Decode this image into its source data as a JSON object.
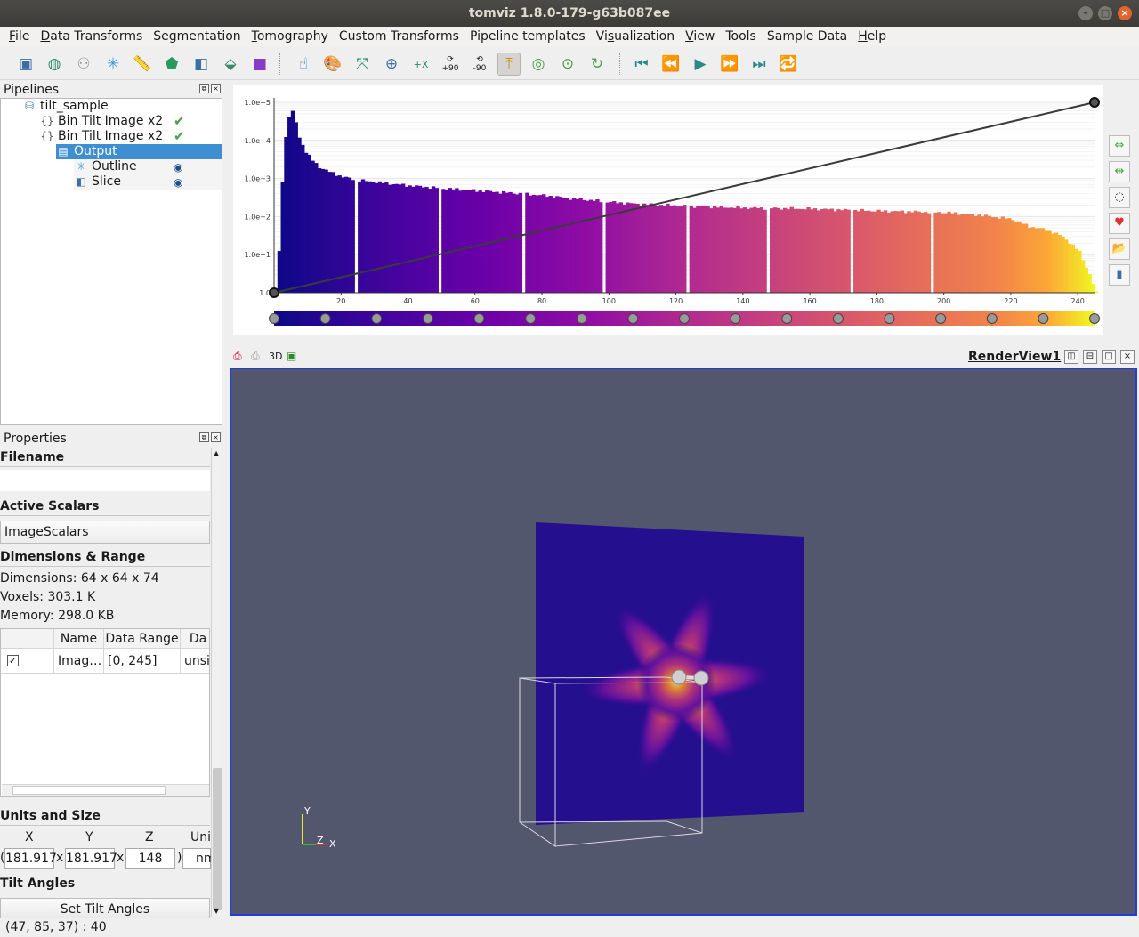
{
  "window": {
    "title": "tomviz 1.8.0-179-g63b087ee"
  },
  "menu": [
    {
      "pre": "",
      "acc": "F",
      "post": "ile"
    },
    {
      "pre": "",
      "acc": "D",
      "post": "ata Transforms"
    },
    {
      "pre": "",
      "acc": "",
      "post": "Segmentation"
    },
    {
      "pre": "",
      "acc": "T",
      "post": "omography"
    },
    {
      "pre": "",
      "acc": "",
      "post": "Custom Transforms"
    },
    {
      "pre": "",
      "acc": "",
      "post": "Pipeline templates"
    },
    {
      "pre": "Vi",
      "acc": "s",
      "post": "ualization"
    },
    {
      "pre": "",
      "acc": "V",
      "post": "iew"
    },
    {
      "pre": "",
      "acc": "",
      "post": "Tools"
    },
    {
      "pre": "",
      "acc": "",
      "post": "Sample Data"
    },
    {
      "pre": "",
      "acc": "H",
      "post": "elp"
    }
  ],
  "toolbar": {
    "rotate_labels": [
      "+90",
      "-90"
    ],
    "x_label": "+X"
  },
  "pipelines": {
    "title": "Pipelines",
    "items": [
      {
        "label": "tilt_sample",
        "icon": "dataset-icon"
      },
      {
        "label": "Bin Tilt Image x2",
        "icon": "braces-icon",
        "status": "complete"
      },
      {
        "label": "Bin Tilt Image x2",
        "icon": "braces-icon",
        "status": "complete"
      },
      {
        "label": "Output",
        "icon": "output-icon",
        "selected": true
      },
      {
        "label": "Outline",
        "icon": "outline-icon",
        "visible": true
      },
      {
        "label": "Slice",
        "icon": "slice-icon",
        "visible": true
      }
    ]
  },
  "properties": {
    "title": "Properties",
    "filename_header": "Filename",
    "filename_value": "",
    "active_scalars_header": "Active Scalars",
    "active_scalars_value": "ImageScalars",
    "dims_header": "Dimensions & Range",
    "dimensions": "Dimensions: 64 x 64 x 74",
    "voxels": "Voxels: 303.1 K",
    "memory": "Memory: 298.0 KB",
    "table": {
      "headers": [
        "",
        "Name",
        "Data Range",
        "Da"
      ],
      "rows": [
        {
          "checked": true,
          "name": "Imag…",
          "range": "[0, 245]",
          "type": "unsig"
        }
      ]
    },
    "units_header": "Units and Size",
    "axes": [
      "X",
      "Y",
      "Z",
      "Uni"
    ],
    "sizes": {
      "x": "181.917",
      "y": "181.917",
      "z": "148",
      "unit": "nm"
    },
    "tilt_header": "Tilt Angles",
    "tilt_button": "Set Tilt Angles"
  },
  "chart_data": {
    "type": "bar",
    "title": "",
    "xlabel": "",
    "ylabel": "",
    "y_scale": "log",
    "xlim": [
      0,
      245
    ],
    "ylim": [
      1,
      100000
    ],
    "y_tick_labels": [
      "1.0",
      "1.0e+1",
      "1.0e+2",
      "1.0e+3",
      "1.0e+4",
      "1.0e+5"
    ],
    "x_tick_labels": [
      "20",
      "40",
      "60",
      "80",
      "100",
      "120",
      "140",
      "160",
      "180",
      "200",
      "220",
      "240"
    ],
    "x_ticks": [
      20,
      40,
      60,
      80,
      100,
      120,
      140,
      160,
      180,
      200,
      220,
      240
    ],
    "colormap": "plasma",
    "opacity_line": {
      "from": [
        0,
        1
      ],
      "to": [
        245,
        100000
      ]
    },
    "colormap_nodes": 17,
    "histogram_profile": [
      [
        0,
        1
      ],
      [
        1,
        12
      ],
      [
        2,
        900
      ],
      [
        3,
        12000
      ],
      [
        4,
        45000
      ],
      [
        5,
        55000
      ],
      [
        6,
        30000
      ],
      [
        7,
        12000
      ],
      [
        9,
        5000
      ],
      [
        11,
        3000
      ],
      [
        13,
        2000
      ],
      [
        16,
        1500
      ],
      [
        20,
        1100
      ],
      [
        25,
        900
      ],
      [
        30,
        800
      ],
      [
        40,
        650
      ],
      [
        50,
        550
      ],
      [
        60,
        480
      ],
      [
        70,
        420
      ],
      [
        80,
        360
      ],
      [
        90,
        290
      ],
      [
        100,
        240
      ],
      [
        110,
        210
      ],
      [
        120,
        195
      ],
      [
        130,
        180
      ],
      [
        140,
        170
      ],
      [
        150,
        165
      ],
      [
        160,
        160
      ],
      [
        170,
        150
      ],
      [
        180,
        140
      ],
      [
        190,
        135
      ],
      [
        200,
        128
      ],
      [
        210,
        110
      ],
      [
        220,
        85
      ],
      [
        225,
        55
      ],
      [
        230,
        45
      ],
      [
        235,
        30
      ],
      [
        240,
        12
      ],
      [
        243,
        3
      ],
      [
        245,
        1
      ]
    ],
    "gaps": [
      24,
      49,
      74,
      98,
      123,
      147,
      172,
      196
    ]
  },
  "renderview": {
    "title": "RenderView1",
    "mode": "3D",
    "axes": {
      "x": "X",
      "y": "Y",
      "z": "Z"
    }
  },
  "status": "(47, 85, 37) : 40",
  "colors": {
    "accent": "#3d8fd1",
    "render_bg": "#52576e",
    "render_border": "#1d3ddc"
  }
}
